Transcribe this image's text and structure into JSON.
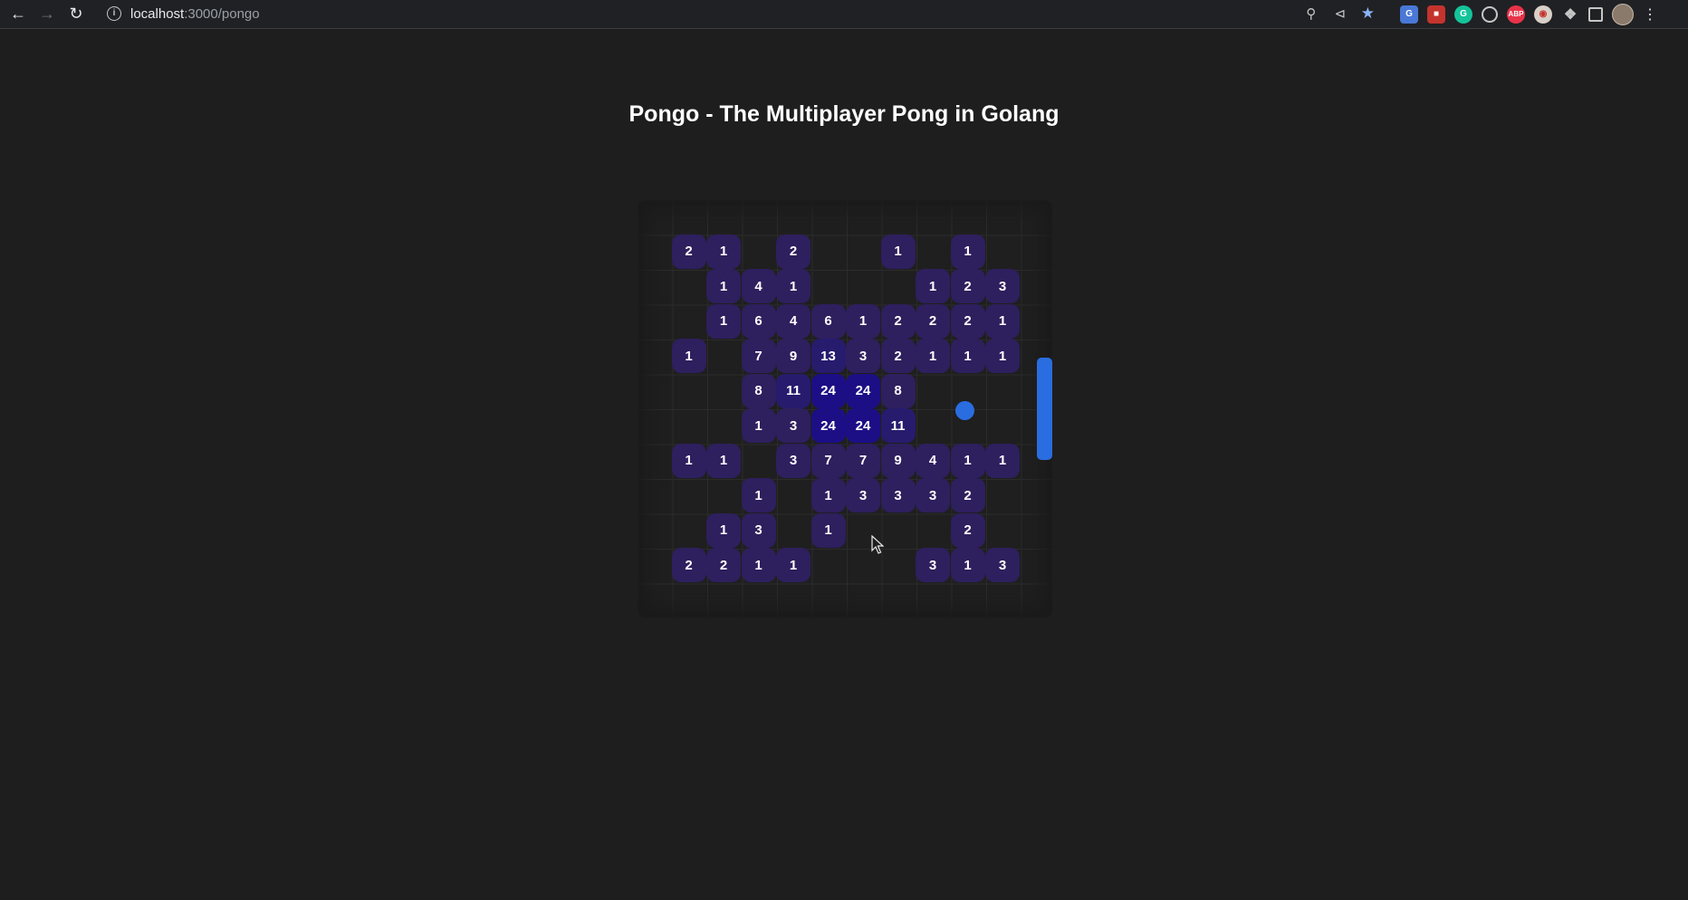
{
  "browser": {
    "url_host": "localhost",
    "url_path": ":3000/pongo",
    "extensions": [
      "translate-ext",
      "pdf-ext",
      "grammarly-ext",
      "target-ext",
      "adblock-ext",
      "eye-ext",
      "puzzle-icon",
      "sidepanel-icon"
    ],
    "adblock_label": "ABP",
    "grammarly_label": "G"
  },
  "page": {
    "title": "Pongo - The Multiplayer Pong in Golang"
  },
  "game": {
    "colors": {
      "cell_low": "#2e1f5e",
      "cell_mid": "#271b6e",
      "cell_high": "#1c0f86",
      "paddle": "#2a6de0",
      "ball": "#2a6de0"
    },
    "grid": [
      [
        "2",
        "1",
        "",
        "2",
        "",
        "",
        "1",
        "",
        "1",
        ""
      ],
      [
        "",
        "1",
        "4",
        "1",
        "",
        "",
        "",
        "1",
        "2",
        "3"
      ],
      [
        "",
        "1",
        "6",
        "4",
        "6",
        "1",
        "2",
        "2",
        "2",
        "1"
      ],
      [
        "1",
        "",
        "7",
        "9",
        "13",
        "3",
        "2",
        "1",
        "1",
        "1"
      ],
      [
        "",
        "",
        "8",
        "11",
        "24",
        "24",
        "8",
        "",
        "",
        ""
      ],
      [
        "",
        "",
        "1",
        "3",
        "24",
        "24",
        "11",
        "",
        "",
        ""
      ],
      [
        "1",
        "1",
        "",
        "3",
        "7",
        "7",
        "9",
        "4",
        "1",
        "1"
      ],
      [
        "",
        "",
        "1",
        "",
        "1",
        "3",
        "3",
        "3",
        "2",
        ""
      ],
      [
        "",
        "1",
        "3",
        "",
        "1",
        "",
        "",
        "",
        "2",
        ""
      ],
      [
        "2",
        "2",
        "1",
        "1",
        "",
        "",
        "",
        "3",
        "1",
        "3"
      ]
    ]
  }
}
